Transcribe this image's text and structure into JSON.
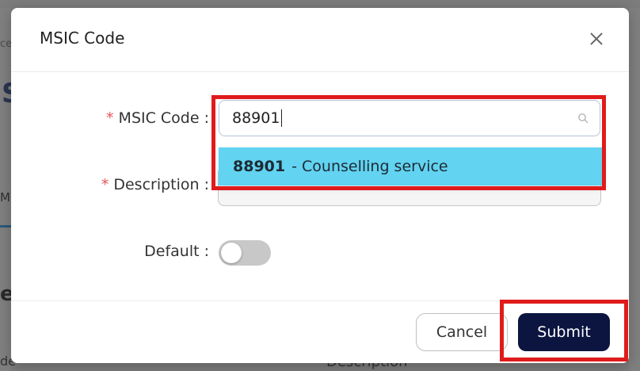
{
  "background": {
    "frag1": "ce",
    "frag2": "S",
    "frag3": "M",
    "frag4": "e",
    "frag5": "de",
    "frag6": "Description"
  },
  "modal": {
    "title": "MSIC Code",
    "close_icon": "close-icon",
    "fields": {
      "msic_code_label": "MSIC Code :",
      "msic_code_value": "88901",
      "description_label": "Description :",
      "default_label": "Default :",
      "required_mark": "*"
    },
    "dropdown": {
      "options": [
        {
          "code": "88901",
          "text": "- Counselling service",
          "highlighted": true
        }
      ]
    },
    "toggle": {
      "state": "off"
    },
    "buttons": {
      "cancel": "Cancel",
      "submit": "Submit"
    }
  },
  "colors": {
    "accent": "#0b1540",
    "option_highlight": "#62d3f1",
    "annotation": "#e01b1b",
    "required": "#e45656"
  }
}
